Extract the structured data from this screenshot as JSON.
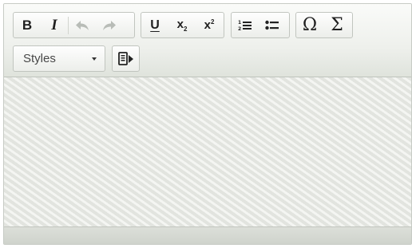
{
  "toolbar": {
    "basic_styles": [
      {
        "label": "B",
        "icon": "bold-icon"
      },
      {
        "label": "I",
        "icon": "italic-icon"
      }
    ],
    "undo_icon": "undo-icon",
    "redo_icon": "redo-icon",
    "text_format": {
      "underline_label": "U",
      "subscript_label": "x",
      "subscript_mark": "2",
      "superscript_label": "x",
      "superscript_mark": "2"
    },
    "lists": [
      "numbered-list-icon",
      "bulleted-list-icon"
    ],
    "symbols": {
      "special_char_label": "Ω",
      "sum_label": "Σ"
    },
    "styles_combo": {
      "selected_value": "Styles"
    },
    "source_icon": "source-mode-icon"
  },
  "colors": {
    "toolbar_text": "#1f1f1f",
    "disabled": "#b3b7b2",
    "border": "#c1c5bf"
  }
}
